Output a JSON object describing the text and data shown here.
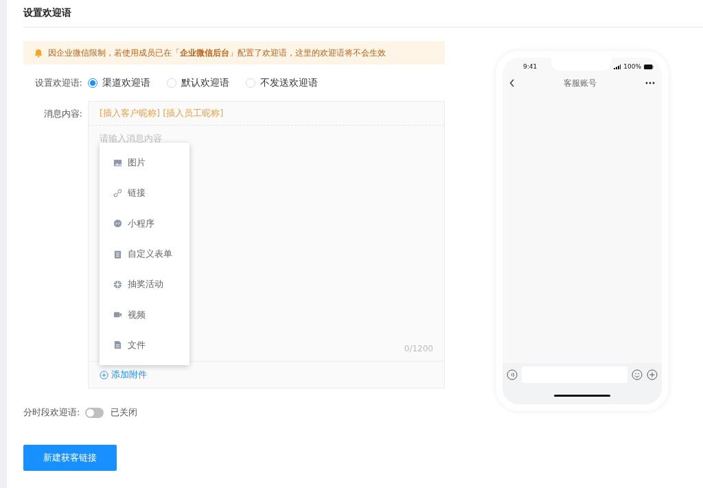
{
  "page_title": "设置欢迎语",
  "alert": {
    "text": "因企业微信限制，若使用成员已在「**企业微信后台**」配置了欢迎语，这里的欢迎语将不会生效"
  },
  "welcome_mode": {
    "label": "设置欢迎语:",
    "options": [
      {
        "label": "渠道欢迎语",
        "selected": true
      },
      {
        "label": "默认欢迎语",
        "selected": false
      },
      {
        "label": "不发送欢迎语",
        "selected": false
      }
    ]
  },
  "message": {
    "label": "消息内容:",
    "insert_tags": [
      "[插入客户昵称]",
      "[插入员工昵称]"
    ],
    "placeholder": "请输入消息内容",
    "counter": "0/1200",
    "add_attachment": "添加附件"
  },
  "attachment_menu": [
    {
      "kind": "image",
      "label": "图片"
    },
    {
      "kind": "link",
      "label": "链接"
    },
    {
      "kind": "miniprogram",
      "label": "小程序"
    },
    {
      "kind": "form",
      "label": "自定义表单"
    },
    {
      "kind": "lottery",
      "label": "抽奖活动"
    },
    {
      "kind": "video",
      "label": "视频"
    },
    {
      "kind": "file",
      "label": "文件"
    }
  ],
  "timed_welcome": {
    "label": "分时段欢迎语:",
    "on": false,
    "status": "已关闭"
  },
  "primary_button": "新建获客链接",
  "phone_preview": {
    "time": "9:41",
    "battery": "100%",
    "title": "客服账号"
  }
}
